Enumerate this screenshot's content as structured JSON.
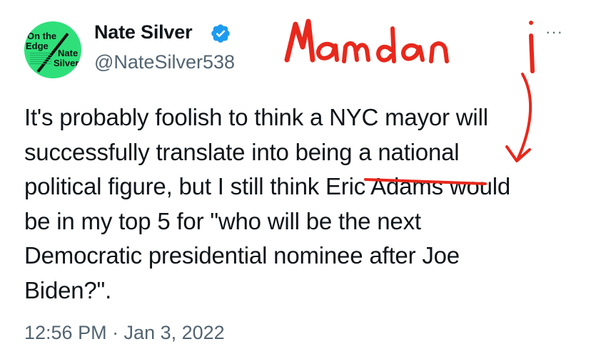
{
  "author": {
    "display_name": "Nate Silver",
    "handle": "@NateSilver538",
    "avatar_text": [
      "On the",
      "Edge",
      "Nate",
      "Silver"
    ],
    "verified": true
  },
  "tweet": {
    "lines": [
      "It's probably foolish to think a NYC mayor will",
      "successfully translate into being a national",
      "political figure, but I still think Eric Adams would",
      "be in my top 5 for \"who will be the next",
      "Democratic presidential nominee after Joe",
      "Biden?\"."
    ]
  },
  "annotation": {
    "handwritten_text": "Mamdani",
    "ink_color": "#e8281c"
  },
  "timestamp": "12:56 PM · Jan 3, 2022",
  "menu": {
    "more_label": "···"
  },
  "colors": {
    "text": "#0f1419",
    "secondary": "#536471",
    "verified": "#1d9bf0",
    "avatar_bg": "#2fe07a"
  }
}
